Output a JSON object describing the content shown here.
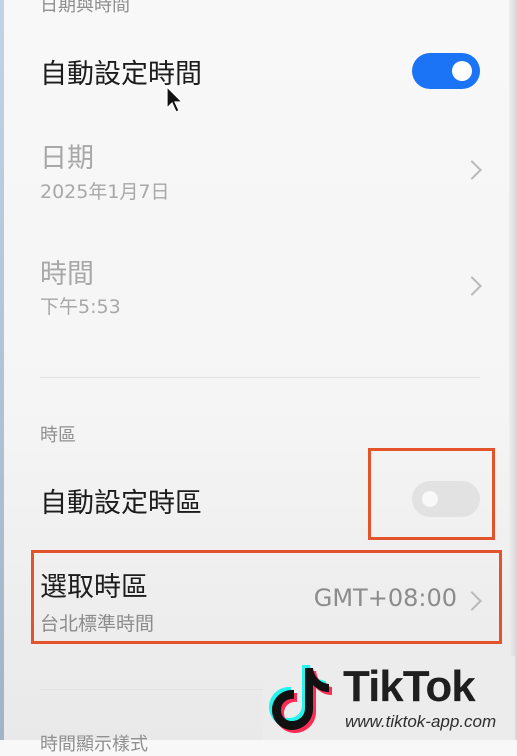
{
  "header": {
    "section_top": "日期與時間"
  },
  "rows": {
    "auto_time": {
      "title": "自動設定時間",
      "toggle": "on"
    },
    "date": {
      "title": "日期",
      "value": "2025年1月7日"
    },
    "time": {
      "title": "時間",
      "value": "下午5:53"
    },
    "timezone_section": {
      "label": "時區"
    },
    "auto_timezone": {
      "title": "自動設定時區",
      "toggle": "off"
    },
    "select_timezone": {
      "title": "選取時區",
      "subtitle": "台北標準時間",
      "value": "GMT+08:00"
    }
  },
  "next_section": {
    "label": "時間顯示樣式"
  },
  "watermark": {
    "brand": "TikTok",
    "url": "www.tiktok-app.com"
  },
  "colors": {
    "toggle_on": "#1b73f5",
    "highlight": "#e4542a",
    "tiktok_cyan": "#25f4ee",
    "tiktok_pink": "#fe2c55"
  },
  "icons": {
    "chevron": "chevron-right-icon",
    "cursor": "mouse-cursor-icon",
    "logo": "tiktok-logo-icon"
  }
}
